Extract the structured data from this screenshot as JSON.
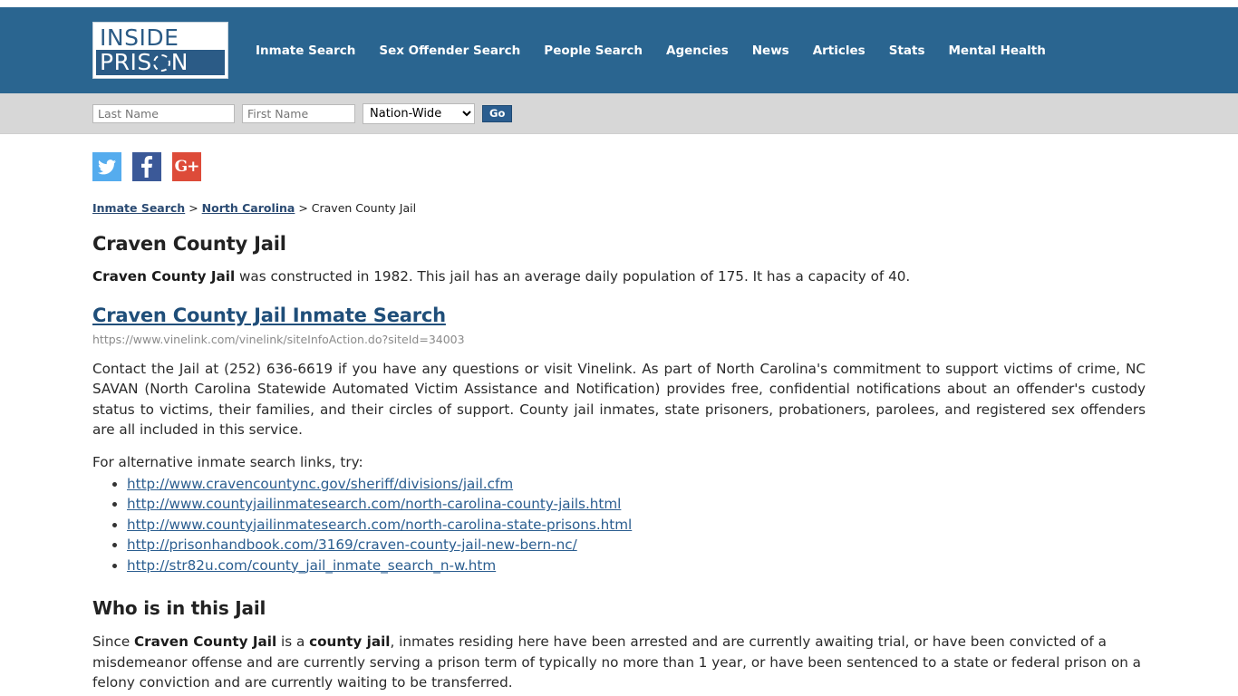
{
  "theme": {
    "header_blue": "#2a6590",
    "logo_blue": "#2b5b86",
    "search_bar_gray": "#d7d7d7",
    "link_blue": "#2a5d8f",
    "heading_link_blue": "#1f4e79",
    "twitter_blue": "#55acee",
    "facebook_blue": "#3b5998",
    "googleplus_red": "#dd4b39"
  },
  "header": {
    "logo": {
      "line1": "INSIDE",
      "line2_before": "PRIS",
      "line2_after": "N",
      "ring_icon": "barbed-wire-ring-icon"
    },
    "nav": [
      {
        "label": "Inmate Search"
      },
      {
        "label": "Sex Offender Search"
      },
      {
        "label": "People Search"
      },
      {
        "label": "Agencies"
      },
      {
        "label": "News"
      },
      {
        "label": "Articles"
      },
      {
        "label": "Stats"
      },
      {
        "label": "Mental Health"
      }
    ]
  },
  "search": {
    "last_name_placeholder": "Last Name",
    "last_name_value": "",
    "first_name_placeholder": "First Name",
    "first_name_value": "",
    "scope_selected": "Nation-Wide",
    "scope_options": [
      "Nation-Wide"
    ],
    "go_label": "Go"
  },
  "social": [
    {
      "name": "twitter",
      "label": "Twitter"
    },
    {
      "name": "facebook",
      "label": "Facebook"
    },
    {
      "name": "googleplus",
      "label": "G+"
    }
  ],
  "breadcrumb": {
    "item1": "Inmate Search",
    "sep1": " > ",
    "item2": "North Carolina",
    "sep2": " > ",
    "current": "Craven County Jail"
  },
  "main": {
    "page_title": "Craven County Jail",
    "intro_bold": "Craven County Jail",
    "intro_rest": " was constructed in 1982. This jail has an average daily population of 175. It has a capacity of 40.",
    "inmate_search_link": "Craven County Jail Inmate Search",
    "inmate_search_url": "https://www.vinelink.com/vinelink/siteInfoAction.do?siteId=34003",
    "contact_paragraph": "Contact the Jail at (252) 636-6619 if you have any questions or visit Vinelink. As part of North Carolina's commitment to support victims of crime, NC SAVAN (North Carolina Statewide Automated Victim Assistance and Notification) provides free, confidential notifications about an offender's custody status to victims, their families, and their circles of support. County jail inmates, state prisoners, probationers, parolees, and registered sex offenders are all included in this service.",
    "alt_links_intro": "For alternative inmate search links, try:",
    "alt_links": [
      "http://www.cravencountync.gov/sheriff/divisions/jail.cfm",
      "http://www.countyjailinmatesearch.com/north-carolina-county-jails.html",
      "http://www.countyjailinmatesearch.com/north-carolina-state-prisons.html",
      "http://prisonhandbook.com/3169/craven-county-jail-new-bern-nc/",
      "http://str82u.com/county_jail_inmate_search_n-w.htm"
    ],
    "who_title": "Who is in this Jail",
    "who_p_1": "Since ",
    "who_p_bold1": "Craven County Jail",
    "who_p_2": " is a ",
    "who_p_bold2": "county jail",
    "who_p_3": ", inmates residing here have been arrested and are currently awaiting trial, or have been convicted of a misdemeanor offense and are currently serving a prison term of typically no more than 1 year, or have been sentenced to a state or federal prison on a felony conviction and are currently waiting to be transferred."
  }
}
